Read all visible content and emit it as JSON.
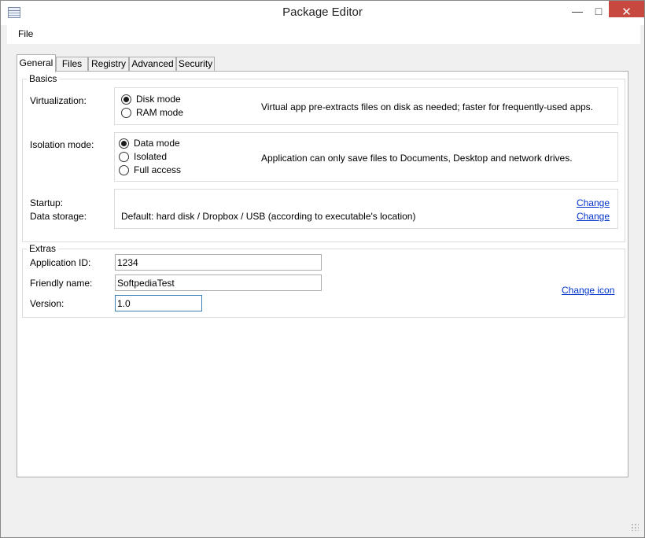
{
  "window": {
    "title": "Package Editor",
    "controls": {
      "minimize": "—",
      "maximize": "□",
      "close": "✕"
    }
  },
  "menu": {
    "file": "File"
  },
  "tabs": [
    {
      "label": "General",
      "active": true
    },
    {
      "label": "Files",
      "active": false
    },
    {
      "label": "Registry",
      "active": false
    },
    {
      "label": "Advanced",
      "active": false
    },
    {
      "label": "Security",
      "active": false
    }
  ],
  "basics": {
    "legend": "Basics",
    "virtualization": {
      "label": "Virtualization:",
      "options": [
        {
          "label": "Disk mode",
          "selected": true
        },
        {
          "label": "RAM mode",
          "selected": false
        }
      ],
      "description": "Virtual app pre-extracts files on disk as needed; faster for frequently-used apps."
    },
    "isolation": {
      "label": "Isolation mode:",
      "options": [
        {
          "label": "Data mode",
          "selected": true
        },
        {
          "label": "Isolated",
          "selected": false
        },
        {
          "label": "Full access",
          "selected": false
        }
      ],
      "description": "Application can only save files to Documents, Desktop and network drives."
    },
    "startup": {
      "label": "Startup:",
      "value": "",
      "link": "Change"
    },
    "data_storage": {
      "label": "Data storage:",
      "value": "Default: hard disk / Dropbox / USB (according to executable's location)",
      "link": "Change"
    }
  },
  "extras": {
    "legend": "Extras",
    "application_id": {
      "label": "Application ID:",
      "value": "1234"
    },
    "friendly_name": {
      "label": "Friendly name:",
      "value": "SoftpediaTest"
    },
    "version": {
      "label": "Version:",
      "value": "1.0"
    },
    "change_icon": "Change icon"
  }
}
